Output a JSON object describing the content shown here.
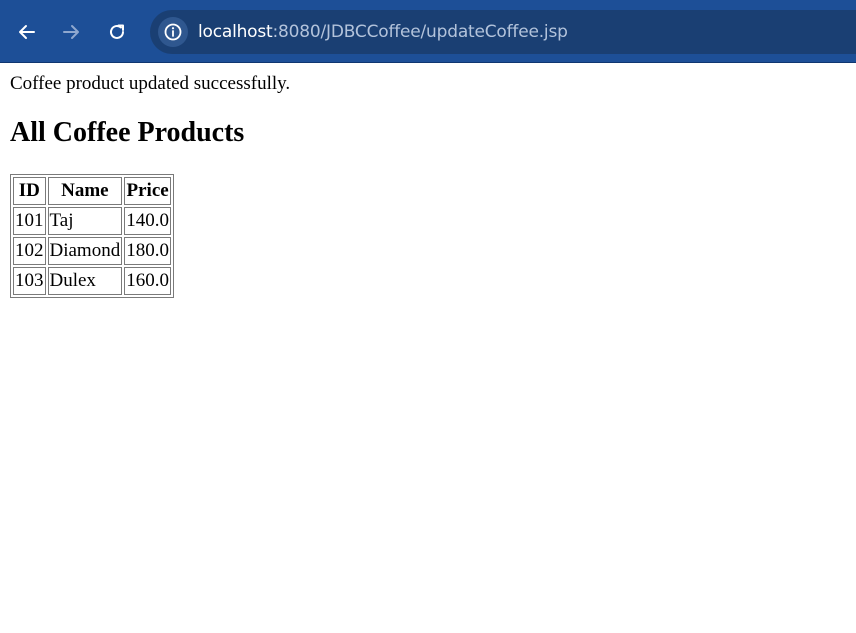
{
  "browser": {
    "url_host": "localhost",
    "url_path": ":8080/JDBCCoffee/updateCoffee.jsp",
    "icons": [
      "back-arrow-icon",
      "forward-arrow-icon",
      "reload-icon",
      "site-info-icon"
    ]
  },
  "page": {
    "message": "Coffee product updated successfully.",
    "heading": "All Coffee Products",
    "table": {
      "headers": [
        "ID",
        "Name",
        "Price"
      ],
      "rows": [
        [
          "101",
          "Taj",
          "140.0"
        ],
        [
          "102",
          "Diamond",
          "180.0"
        ],
        [
          "103",
          "Dulex",
          "160.0"
        ]
      ]
    }
  }
}
